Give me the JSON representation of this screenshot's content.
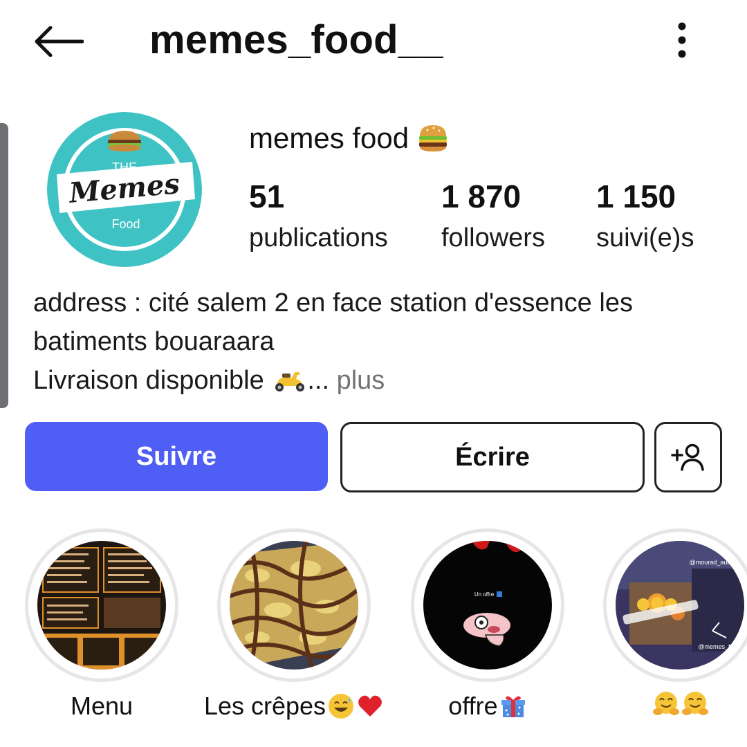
{
  "header": {
    "username": "memes_food__"
  },
  "profile": {
    "display_name": "memes food",
    "avatar_text": {
      "the": "THE",
      "memes": "Memes",
      "food": "Food"
    },
    "stats": [
      {
        "value": "51",
        "label": "publications"
      },
      {
        "value": "1 870",
        "label": "followers"
      },
      {
        "value": "1 150",
        "label": "suivi(e)s"
      }
    ],
    "bio": {
      "line1": "address : cité salem 2 en face station d'essence les",
      "line2": "batiments bouaraara",
      "line3": "Livraison disponible ",
      "ellipsis": "...",
      "more": " plus"
    }
  },
  "actions": {
    "follow_label": "Suivre",
    "message_label": "Écrire"
  },
  "highlights": [
    {
      "label": "Menu"
    },
    {
      "label": "Les crêpes "
    },
    {
      "label": "offre"
    },
    {
      "label": ""
    }
  ],
  "highlight_texts": {
    "offer_text": "Un offre",
    "story_handle_1": "@mourad_audio",
    "story_handle_2": "@memes_food"
  },
  "colors": {
    "accent": "#4f5ef5",
    "avatar_bg": "#3fc2c4",
    "muted_text": "#737373"
  },
  "icons": {
    "back": "arrow-left-icon",
    "more": "vertical-dots-icon",
    "add_user": "add-user-icon",
    "name_emoji": "burger-icon",
    "bio_emoji": "scooter-icon"
  }
}
